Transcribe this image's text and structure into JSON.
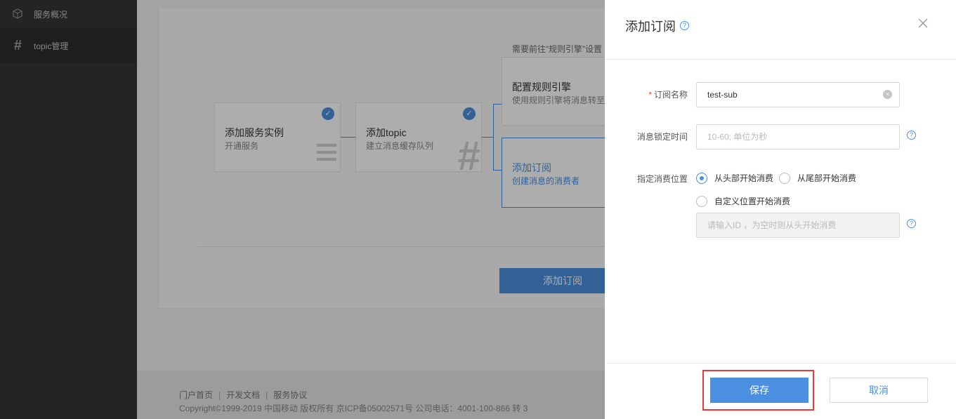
{
  "sidebar": {
    "items": [
      {
        "label": "服务概况",
        "icon": "cube-icon"
      },
      {
        "label": "topic管理",
        "icon": "hash-icon"
      }
    ]
  },
  "steps": {
    "step1": {
      "title": "添加服务实例",
      "desc": "开通服务",
      "glyph": "≡"
    },
    "step2": {
      "title": "添加topic",
      "desc": "建立消息缓存队列",
      "glyph": "#"
    },
    "step3": {
      "note": "需要前往“规则引擎”设置",
      "title": "配置规则引擎",
      "desc": "使用规则引擎将消息转至"
    },
    "step4": {
      "title": "添加订阅",
      "desc": "创建消息的消费者"
    }
  },
  "main_button": "添加订阅",
  "footer": {
    "links": [
      "门户首页",
      "开发文档",
      "服务协议"
    ],
    "copyright": "Copyright©1999-2019 中国移动 版权所有 京ICP备05002571号 公司电话：4001-100-866 转 3"
  },
  "drawer": {
    "title": "添加订阅",
    "form": {
      "name_label": "订阅名称",
      "name_value": "test-sub",
      "lock_label": "消息锁定时间",
      "lock_placeholder": "10-60; 单位为秒",
      "position_label": "指定消费位置",
      "option_head": "从头部开始消费",
      "option_tail": "从尾部开始消费",
      "option_custom": "自定义位置开始消费",
      "id_placeholder": "请输入ID ，为空时则从头开始消费"
    },
    "save_label": "保存",
    "cancel_label": "取消"
  },
  "colors": {
    "accent": "#4a8fe0",
    "highlight": "#e23b3b",
    "sidebar": "#333538"
  }
}
